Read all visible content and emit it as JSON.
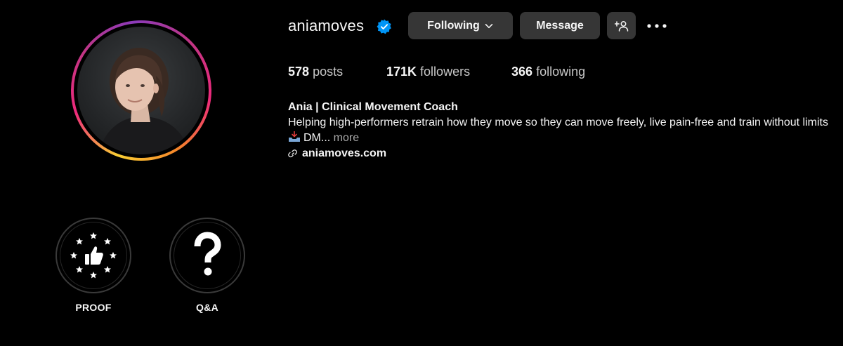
{
  "profile": {
    "username": "aniamoves",
    "verified": true,
    "accent_color": "#0095f6",
    "buttons": {
      "following_label": "Following",
      "message_label": "Message"
    },
    "stats": {
      "posts_count": "578",
      "posts_label": "posts",
      "followers_count": "171K",
      "followers_label": "followers",
      "following_count": "366",
      "following_label": "following"
    },
    "bio": {
      "name": "Ania | Clinical Movement Coach",
      "line1": "Helping high-performers retrain how they move so they can move freely, live pain-free and train without limits",
      "line2_text": "DM...",
      "more_label": "more",
      "link": "aniamoves.com"
    }
  },
  "highlights": [
    {
      "label": "PROOF",
      "icon": "thumbs-up-stars-icon"
    },
    {
      "label": "Q&A",
      "icon": "question-mark-icon"
    }
  ]
}
